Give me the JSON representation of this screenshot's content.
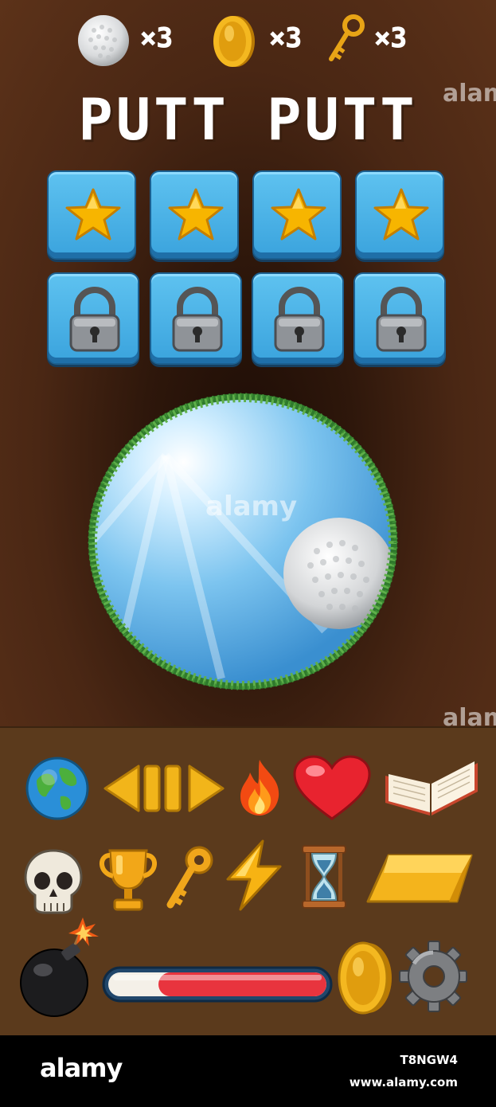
{
  "resources": {
    "golf_balls": {
      "icon": "golf-ball-icon",
      "count": "×3"
    },
    "coins": {
      "icon": "coin-icon",
      "count": "×3"
    },
    "keys": {
      "icon": "key-icon",
      "count": "×3"
    }
  },
  "title": "PUTT PUTT",
  "levels": {
    "unlocked": [
      {
        "state": "unlocked",
        "icon": "star-icon"
      },
      {
        "state": "unlocked",
        "icon": "star-icon"
      },
      {
        "state": "unlocked",
        "icon": "star-icon"
      },
      {
        "state": "unlocked",
        "icon": "star-icon"
      }
    ],
    "locked": [
      {
        "state": "locked",
        "icon": "padlock-icon"
      },
      {
        "state": "locked",
        "icon": "padlock-icon"
      },
      {
        "state": "locked",
        "icon": "padlock-icon"
      },
      {
        "state": "locked",
        "icon": "padlock-icon"
      }
    ]
  },
  "icon_set": {
    "row1": [
      "globe-icon",
      "media-controls-icon",
      "fire-icon",
      "heart-icon",
      "book-icon"
    ],
    "row2": [
      "skull-icon",
      "trophy-icon",
      "key-icon",
      "lightning-icon",
      "hourglass-icon",
      "gold-bar-icon"
    ],
    "row3": [
      "bomb-icon",
      "progress-bar",
      "coin-icon",
      "gear-icon"
    ]
  },
  "progress": {
    "fill_fraction": 0.77,
    "fill_color": "#e8343e",
    "track_color": "#f4f0e8"
  },
  "colors": {
    "level_tile": "#45aee6",
    "star": "#f5b300",
    "background": "#4a2714",
    "panel": "#5b3a1c"
  },
  "watermark": {
    "text": "alamy"
  },
  "footer": {
    "brand": "alamy",
    "image_id": "T8NGW4",
    "url": "www.alamy.com"
  }
}
